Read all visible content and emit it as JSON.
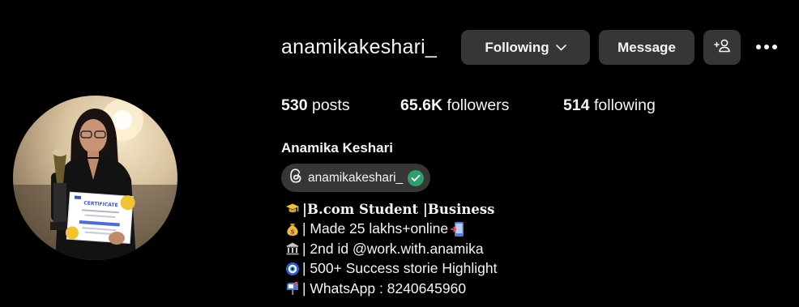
{
  "profile": {
    "username": "anamikakeshari_",
    "full_name": "Anamika Keshari",
    "threads_handle": "anamikakeshari_"
  },
  "actions": {
    "following_label": "Following",
    "message_label": "Message",
    "suggest_icon": "add-person-icon",
    "more_icon": "more-horizontal-icon"
  },
  "stats": {
    "posts_count": "530",
    "posts_label": "posts",
    "followers_count": "65.6K",
    "followers_label": "followers",
    "following_count": "514",
    "following_label": "following"
  },
  "avatar": {
    "certificate_title": "CERTIFICATE"
  },
  "bio": [
    {
      "icon": "graduation-cap-icon",
      "text": "|B.com Student |Business",
      "style": "serif"
    },
    {
      "icon": "money-bag-icon",
      "text": "| Made 25 lakhs+online",
      "trailing_icon": "mobile-arrow-icon"
    },
    {
      "icon": "bank-icon",
      "text": "| 2nd id @work.with.anamika"
    },
    {
      "icon": "nazar-amulet-icon",
      "text": "| 500+ Success storie Highlight"
    },
    {
      "icon": "mailbox-icon",
      "text": "| WhatsApp : 8240645960"
    }
  ],
  "colors": {
    "background": "#000000",
    "button": "#363636",
    "text": "#f5f5f5",
    "verified": "#2e9e6b"
  }
}
